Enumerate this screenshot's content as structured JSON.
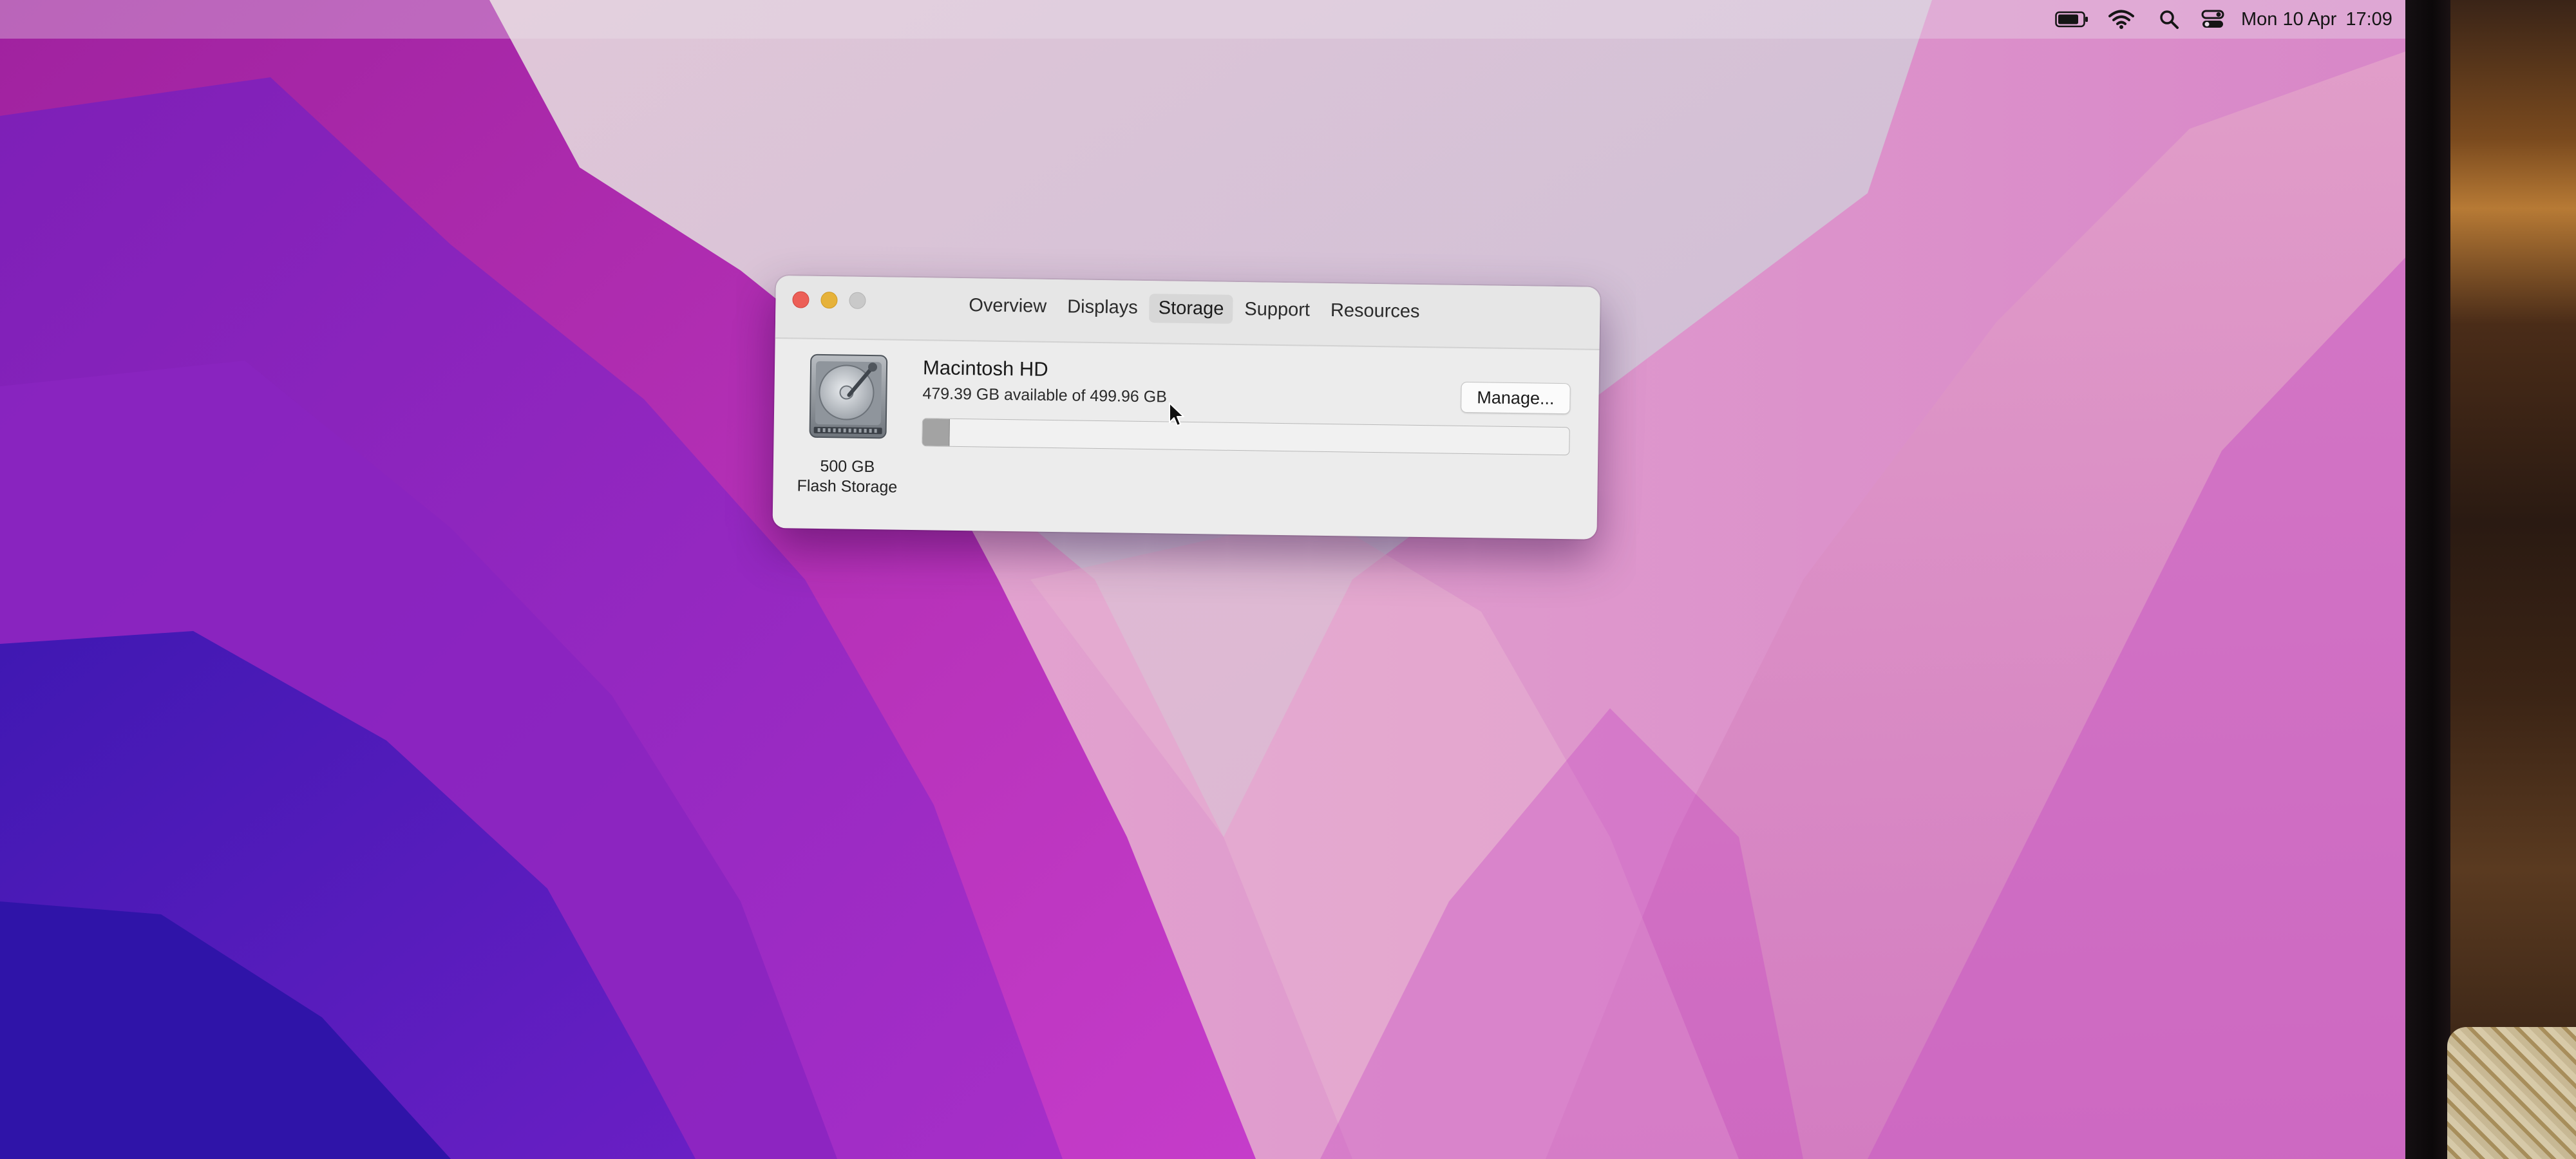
{
  "menubar": {
    "date": "Mon 10 Apr",
    "time": "17:09",
    "icons": [
      "battery-icon",
      "wifi-icon",
      "search-icon",
      "control-center-icon"
    ]
  },
  "window": {
    "tabs": [
      {
        "label": "Overview"
      },
      {
        "label": "Displays"
      },
      {
        "label": "Storage"
      },
      {
        "label": "Support"
      },
      {
        "label": "Resources"
      }
    ],
    "active_tab": "Storage",
    "disk": {
      "icon": "hard-drive-icon",
      "size": "500 GB",
      "type": "Flash Storage"
    },
    "volume": {
      "name": "Macintosh HD",
      "available_text": "479.39 GB available of 499.96 GB",
      "used_fraction": 0.041
    },
    "manage_label": "Manage..."
  },
  "colors": {
    "close": "#ec5f57",
    "minimize": "#e6b23a",
    "zoom": "#c9c9c9",
    "usage_fill": "#a3a3a3"
  }
}
